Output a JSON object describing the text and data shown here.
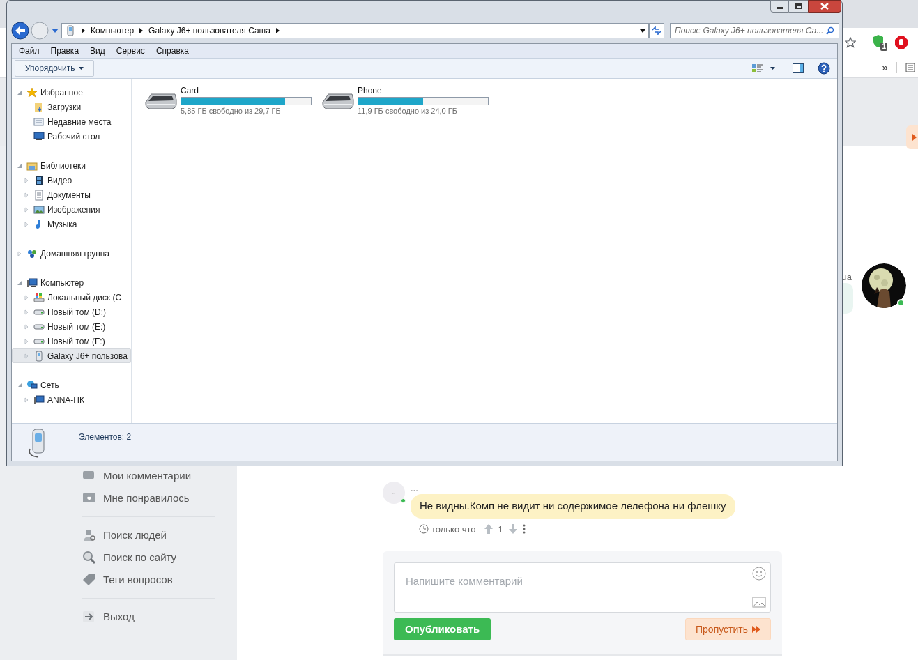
{
  "browser": {
    "extension_badge": "1",
    "overflow": "»"
  },
  "page": {
    "sidebar": [
      {
        "kind": "comments",
        "label": "Мои комментарии"
      },
      {
        "kind": "like",
        "label": "Мне понравилось"
      },
      {
        "kind": "divider"
      },
      {
        "kind": "people",
        "label": "Поиск людей"
      },
      {
        "kind": "search",
        "label": "Поиск по сайту"
      },
      {
        "kind": "tags",
        "label": "Теги вопросов"
      },
      {
        "kind": "divider"
      },
      {
        "kind": "exit",
        "label": "Выход"
      }
    ],
    "partial_text": "ua",
    "comment": {
      "avatar_text": "..",
      "author": "...",
      "online": true,
      "text": "Не видны.Комп не видит ни содержимое лелефона ни флешку",
      "time": "только что",
      "votes": "1"
    },
    "compose": {
      "placeholder": "Напишите комментарий",
      "publish": "Опубликовать",
      "skip": "Пропустить"
    }
  },
  "explorer": {
    "address": [
      "Компьютер",
      "Galaxy J6+ пользователя Саша"
    ],
    "search": {
      "placeholder": "Поиск: Galaxy J6+ пользователя Са..."
    },
    "menu": [
      "Файл",
      "Правка",
      "Вид",
      "Сервис",
      "Справка"
    ],
    "organize": "Упорядочить",
    "nav_tree": [
      {
        "kind": "star",
        "label": "Избранное",
        "expanded": true,
        "selected": false,
        "children": [
          {
            "kind": "downloads",
            "label": "Загрузки",
            "selected": false
          },
          {
            "kind": "recent",
            "label": "Недавние места",
            "selected": false
          },
          {
            "kind": "desktop",
            "label": "Рабочий стол",
            "selected": false
          }
        ]
      },
      {
        "kind": "library",
        "label": "Библиотеки",
        "expanded": true,
        "selected": false,
        "children": [
          {
            "kind": "video",
            "label": "Видео",
            "expanded": false,
            "selected": false
          },
          {
            "kind": "docs",
            "label": "Документы",
            "expanded": false,
            "selected": false
          },
          {
            "kind": "images",
            "label": "Изображения",
            "expanded": false,
            "selected": false
          },
          {
            "kind": "music",
            "label": "Музыка",
            "expanded": false,
            "selected": false
          }
        ]
      },
      {
        "kind": "homegroup",
        "label": "Домашняя группа",
        "expanded": false,
        "selected": false
      },
      {
        "kind": "computer",
        "label": "Компьютер",
        "expanded": true,
        "selected": false,
        "children": [
          {
            "kind": "sysdrive",
            "label": "Локальный диск (C",
            "expanded": false,
            "selected": false
          },
          {
            "kind": "drive",
            "label": "Новый том (D:)",
            "expanded": false,
            "selected": false
          },
          {
            "kind": "drive",
            "label": "Новый том (E:)",
            "expanded": false,
            "selected": false
          },
          {
            "kind": "drive",
            "label": "Новый том (F:)",
            "expanded": false,
            "selected": false
          },
          {
            "kind": "phone",
            "label": "Galaxy J6+ пользова",
            "expanded": false,
            "selected": true
          }
        ]
      },
      {
        "kind": "network",
        "label": "Сеть",
        "expanded": true,
        "selected": false,
        "children": [
          {
            "kind": "pc",
            "label": "ANNA-ПК",
            "expanded": false,
            "selected": false
          }
        ]
      }
    ],
    "drives": [
      {
        "name": "Card",
        "level": 0.8,
        "reading": "5,85 ГБ свободно из 29,7 ГБ"
      },
      {
        "name": "Phone",
        "level": 0.5,
        "reading": "11,9 ГБ свободно из 24,0 ГБ"
      }
    ],
    "status": "Элементов: 2"
  }
}
